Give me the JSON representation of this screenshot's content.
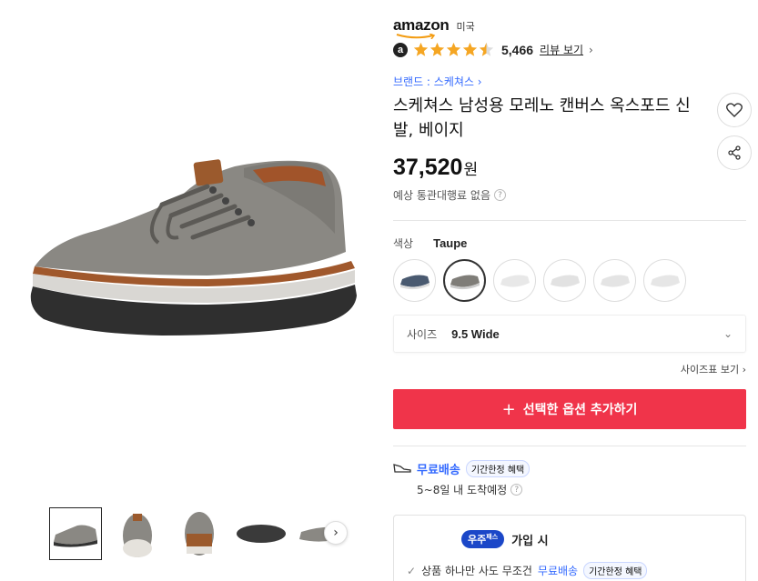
{
  "seller": {
    "brand_logo": "amazon",
    "country": "미국"
  },
  "rating": {
    "badge": "a",
    "stars": 4.5,
    "count": "5,466",
    "review_link": "리뷰 보기"
  },
  "brand_link": "브랜드 : 스케쳐스",
  "product": {
    "title": "스케쳐스 남성용 모레노 캔버스 옥스포드 신발, 베이지",
    "price": "37,520",
    "currency": "원"
  },
  "customs_text": "예상 통관대행료 없음",
  "color": {
    "label": "색상",
    "selected": "Taupe",
    "swatch_count": 6,
    "selected_index": 1
  },
  "size": {
    "label": "사이즈",
    "selected": "9.5 Wide",
    "chart_link": "사이즈표 보기"
  },
  "add_button": "선택한 옵션 추가하기",
  "shipping": {
    "title": "무료배송",
    "badge": "기간한정 혜택",
    "eta": "5~8일 내 도착예정"
  },
  "membership": {
    "badge": "우주",
    "badge_sup": "패스",
    "title": "가입 시",
    "benefit": "상품 하나만 사도 무조건",
    "benefit_highlight": "무료배송",
    "benefit_badge": "기간한정 혜택"
  },
  "icons": [
    "heart-icon",
    "share-icon",
    "chevron-right-icon",
    "chevron-down-icon",
    "question-icon",
    "shoe-icon",
    "plus-icon",
    "check-icon"
  ],
  "colors": {
    "accent_red": "#f0344a",
    "link_blue": "#346aff",
    "star": "#f5a623",
    "wow_blue": "#1b47c8"
  }
}
